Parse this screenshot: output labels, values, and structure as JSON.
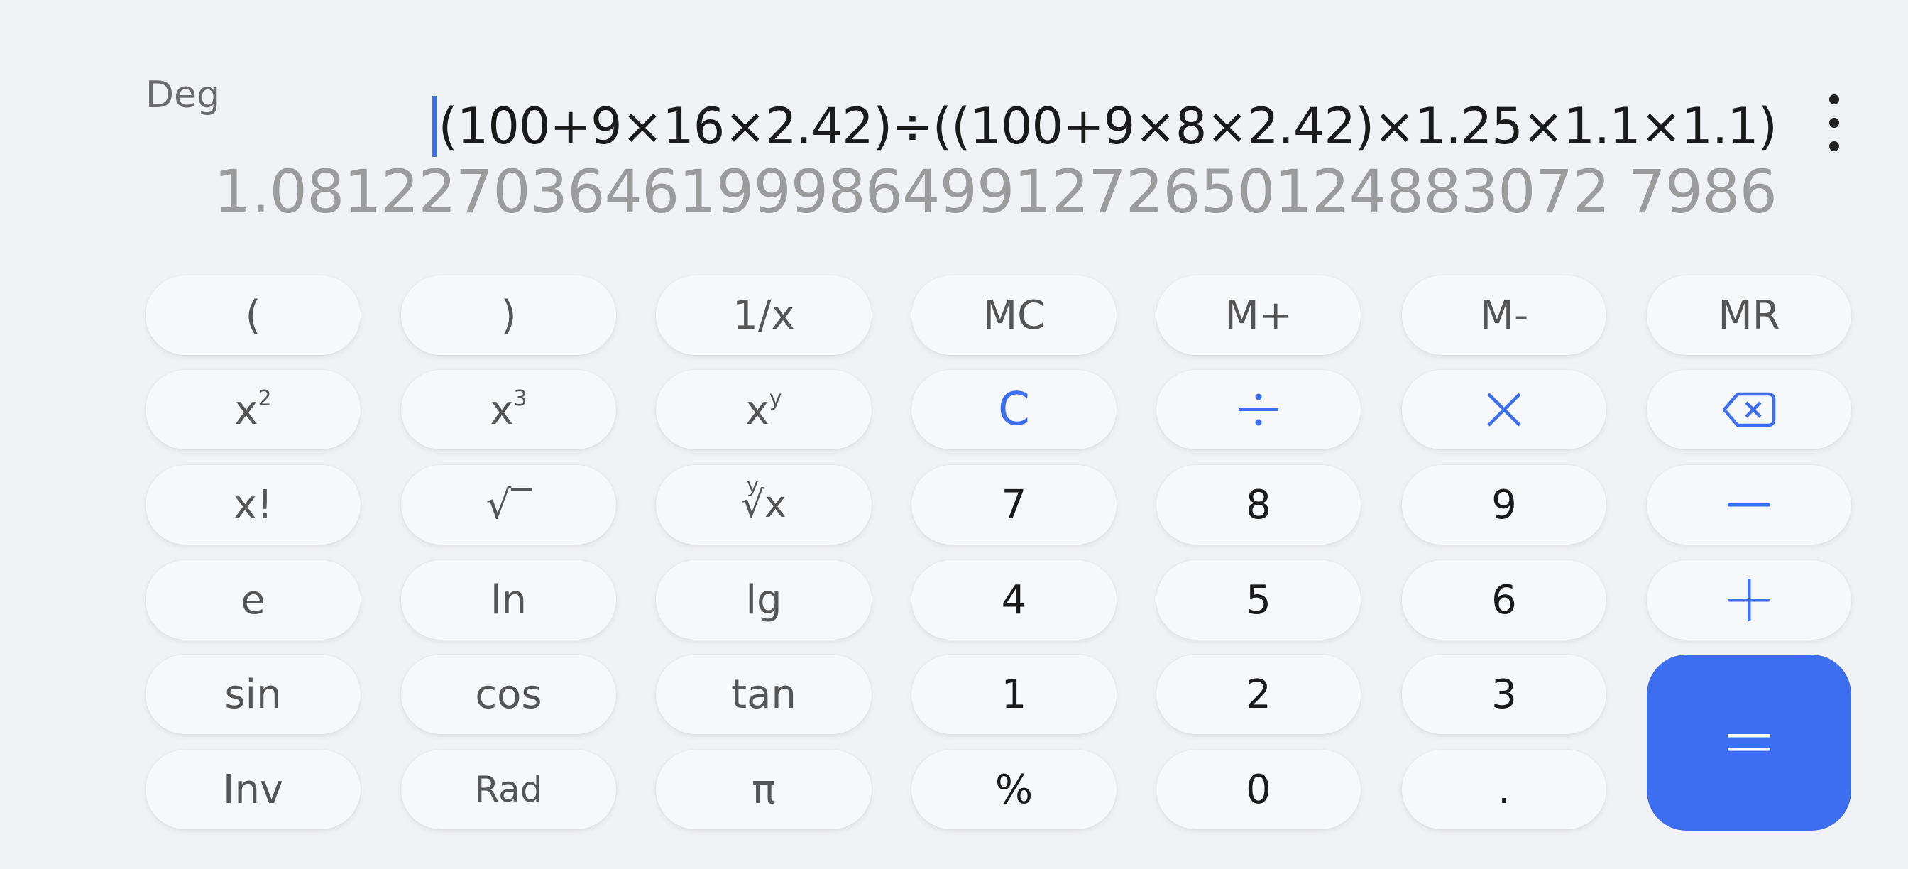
{
  "display": {
    "angle_mode": "Deg",
    "expression": "(100+9×16×2.42)÷((100+9×8×2.42)×1.25×1.1×1.1)",
    "result": "1.081227036461999864991272650124883072 7986"
  },
  "keys": {
    "open_paren": "(",
    "close_paren": ")",
    "reciprocal": "1/x",
    "mc": "MC",
    "m_plus": "M+",
    "m_minus": "M-",
    "mr": "MR",
    "square_base": "x",
    "square_exp": "2",
    "cube_base": "x",
    "cube_exp": "3",
    "power_base": "x",
    "power_exp": "y",
    "clear": "C",
    "factorial": "x!",
    "sqrt": "√‾",
    "root_y": "y",
    "root_x": "√x",
    "seven": "7",
    "eight": "8",
    "nine": "9",
    "e": "e",
    "ln": "ln",
    "lg": "lg",
    "four": "4",
    "five": "5",
    "six": "6",
    "sin": "sin",
    "cos": "cos",
    "tan": "tan",
    "one": "1",
    "two": "2",
    "three": "3",
    "inv": "Inv",
    "rad": "Rad",
    "pi": "π",
    "percent": "%",
    "zero": "0",
    "decimal": "."
  },
  "colors": {
    "accent": "#3d6ef0",
    "background": "#f1f2f6",
    "key_background": "#f7f8fa"
  },
  "icons": {
    "divide": "divide-icon",
    "multiply": "multiply-icon",
    "backspace": "backspace-icon",
    "minus": "minus-icon",
    "plus": "plus-icon",
    "equals": "equals-icon",
    "more": "more-vertical-icon"
  }
}
